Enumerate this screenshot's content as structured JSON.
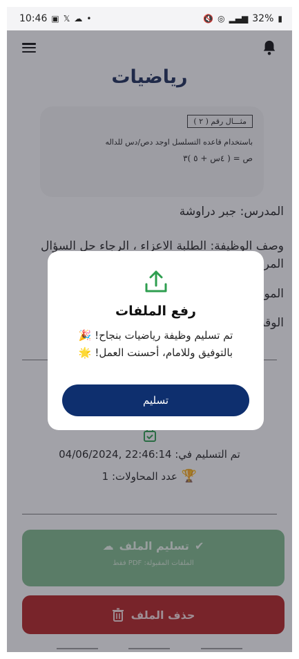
{
  "status_bar": {
    "time": "10:46",
    "left_icons": [
      "gallery-icon",
      "x-icon",
      "cloud-icon",
      "dot-icon"
    ],
    "battery": "32%"
  },
  "header": {
    "title": "رياضيات"
  },
  "question_image": {
    "example_label": "مثـــال رقم ( ٢ )",
    "line1": "باستخدام قاعده التسلسل اوجد دص/دس للداله",
    "line2": "ص = ( ٤س + ٥ )٣"
  },
  "info": {
    "teacher": "المدرس: جبر دراوشة",
    "description_line1": "وصف الوظيفة: الطلبة الاعزاء ، الرجاء حل السؤال",
    "description_line2": "المرفق",
    "due_fragment": "الموعد",
    "time_fragment": "الوقت"
  },
  "submission": {
    "submitted_at": "تم التسليم في: 22:46:14 ,04/06/2024",
    "attempts": "عدد المحاولات: 1"
  },
  "buttons": {
    "submit_file": "تسليم الملف",
    "allowed_files": "الملفات المقبولة: PDF فقط",
    "delete_file": "حذف الملف"
  },
  "modal": {
    "title": "رفع الملفات",
    "message_line1": "تم تسليم وظيفة رياضيات بنجاح! 🎉",
    "message_line2": "بالتوفيق وللامام، أحسنت العمل! 🌟",
    "confirm": "تسليم"
  },
  "colors": {
    "primary": "#0e2f6e",
    "success": "#7fb88a",
    "danger": "#b22222",
    "accent_green": "#2e9e4f"
  }
}
